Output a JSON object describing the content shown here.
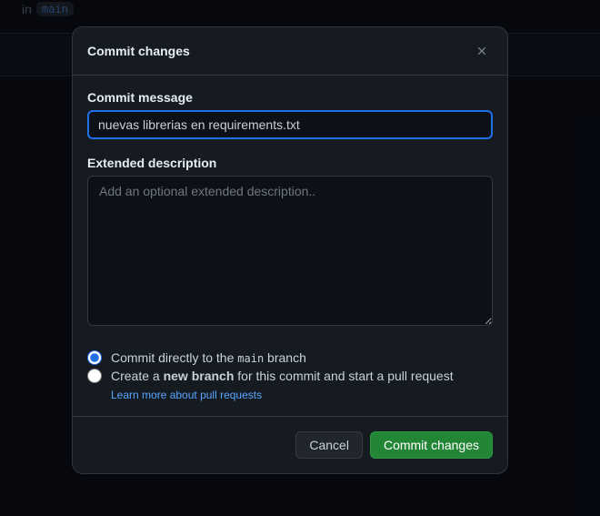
{
  "background": {
    "in_text": "in",
    "branch": "main"
  },
  "modal": {
    "title": "Commit changes",
    "commit_message_label": "Commit message",
    "commit_message_value": "nuevas librerias en requirements.txt",
    "extended_label": "Extended description",
    "extended_placeholder": "Add an optional extended description..",
    "radio": {
      "direct_pre": "Commit directly to the ",
      "direct_branch": "main",
      "direct_post": " branch",
      "newbranch_pre": "Create a ",
      "newbranch_strong": "new branch",
      "newbranch_post": " for this commit and start a pull request",
      "learn_more": "Learn more about pull requests"
    },
    "cancel_label": "Cancel",
    "commit_button_label": "Commit changes"
  }
}
